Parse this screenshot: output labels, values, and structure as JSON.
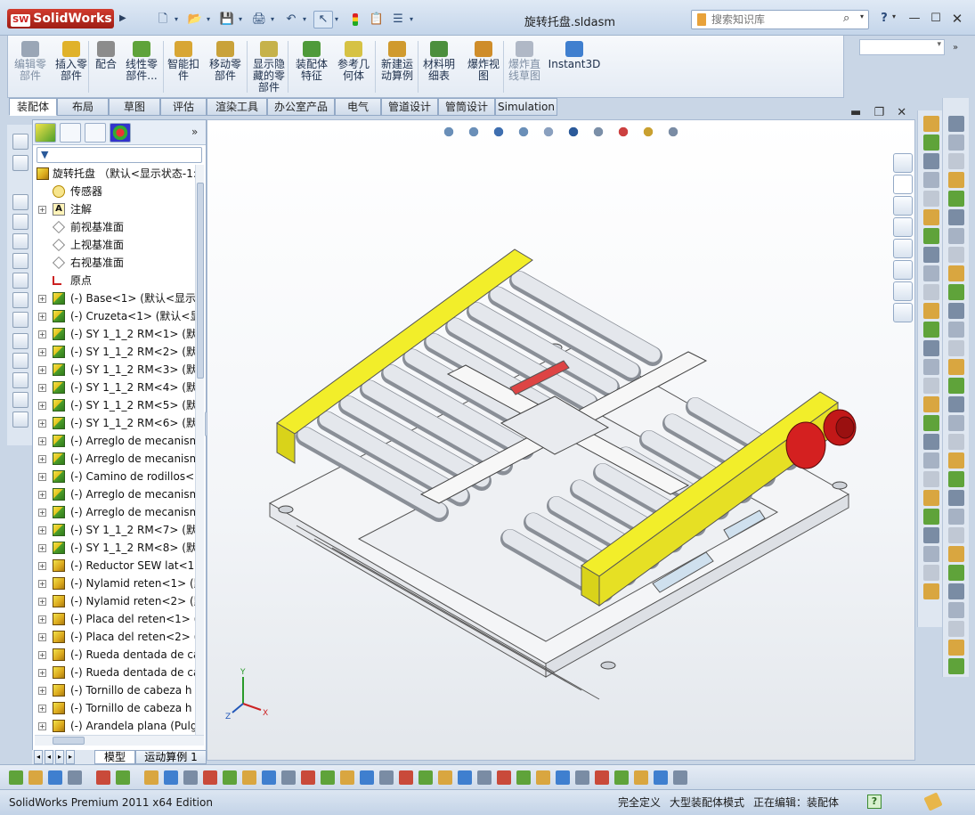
{
  "app": {
    "logo_text": "SolidWorks",
    "logo_badge": "SW",
    "document_title": "旋转托盘.sldasm",
    "search_placeholder": "搜索知识库",
    "help_label": "?"
  },
  "quick_access": [
    {
      "name": "new-document-icon",
      "glyph": "🗋"
    },
    {
      "name": "open-icon",
      "glyph": "📂"
    },
    {
      "name": "save-icon",
      "glyph": "💾"
    },
    {
      "name": "print-icon",
      "glyph": "🖨"
    },
    {
      "name": "undo-icon",
      "glyph": "↶"
    },
    {
      "name": "select-icon",
      "glyph": "↖"
    },
    {
      "name": "rebuild-icon",
      "glyph": "🚦"
    },
    {
      "name": "file-properties-icon",
      "glyph": "📋"
    },
    {
      "name": "options-icon",
      "glyph": "☰"
    }
  ],
  "ribbon": {
    "buttons": [
      {
        "label": "编辑零\n部件",
        "disabled": true,
        "color": "#9aa6b6"
      },
      {
        "label": "插入零\n部件",
        "disabled": false,
        "color": "#e0b22a"
      },
      {
        "label": "配合",
        "disabled": false,
        "color": "#8c8c8c"
      },
      {
        "label": "线性零\n部件...",
        "disabled": false,
        "color": "#5fa33a"
      },
      {
        "label": "智能扣\n件",
        "disabled": false,
        "color": "#d8a634"
      },
      {
        "label": "移动零\n部件",
        "disabled": false,
        "color": "#c9a23a"
      },
      {
        "label": "显示隐\n藏的零\n部件",
        "disabled": false,
        "color": "#c6b24a"
      },
      {
        "label": "装配体\n特征",
        "disabled": false,
        "color": "#4f9a3a"
      },
      {
        "label": "参考几\n何体",
        "disabled": false,
        "color": "#d6c244"
      },
      {
        "label": "新建运\n动算例",
        "disabled": false,
        "color": "#d09a2e"
      },
      {
        "label": "材料明\n细表",
        "disabled": false,
        "color": "#4c8f3d"
      },
      {
        "label": "爆炸视\n图",
        "disabled": false,
        "color": "#cf8d2a"
      },
      {
        "label": "爆炸直\n线草图",
        "disabled": true,
        "color": "#b0b8c6"
      },
      {
        "label": "Instant3D",
        "disabled": false,
        "color": "#3f7fcf"
      }
    ]
  },
  "tabs": [
    "装配体",
    "布局",
    "草图",
    "评估",
    "渲染工具",
    "办公室产品",
    "电气",
    "管道设计",
    "管筒设计",
    "Simulation"
  ],
  "active_tab": "装配体",
  "feature_tree": {
    "root_label": "旋转托盘 （默认<显示状态-1:",
    "items": [
      {
        "label": "传感器",
        "icon": "sensor",
        "expand": false
      },
      {
        "label": "注解",
        "icon": "note",
        "expand": true
      },
      {
        "label": "前视基准面",
        "icon": "plane",
        "expand": false
      },
      {
        "label": "上视基准面",
        "icon": "plane",
        "expand": false
      },
      {
        "label": "右视基准面",
        "icon": "plane",
        "expand": false
      },
      {
        "label": "原点",
        "icon": "origin",
        "expand": false
      },
      {
        "label": "(-) Base<1> (默认<显示:",
        "icon": "cube",
        "expand": true
      },
      {
        "label": "(-) Cruzeta<1> (默认<显",
        "icon": "cube",
        "expand": true
      },
      {
        "label": "(-) SY 1_1_2 RM<1> (默认",
        "icon": "cube",
        "expand": true
      },
      {
        "label": "(-) SY 1_1_2 RM<2> (默认",
        "icon": "cube",
        "expand": true
      },
      {
        "label": "(-) SY 1_1_2 RM<3> (默认",
        "icon": "cube",
        "expand": true
      },
      {
        "label": "(-) SY 1_1_2 RM<4> (默认",
        "icon": "cube",
        "expand": true
      },
      {
        "label": "(-) SY 1_1_2 RM<5> (默认",
        "icon": "cube",
        "expand": true
      },
      {
        "label": "(-) SY 1_1_2 RM<6> (默认",
        "icon": "cube",
        "expand": true
      },
      {
        "label": "(-) Arreglo de mecanism",
        "icon": "cube",
        "expand": true
      },
      {
        "label": "(-) Arreglo de mecanism",
        "icon": "cube",
        "expand": true
      },
      {
        "label": "(-) Camino de rodillos<",
        "icon": "cube",
        "expand": true
      },
      {
        "label": "(-) Arreglo de mecanism",
        "icon": "cube",
        "expand": true
      },
      {
        "label": "(-) Arreglo de mecanism",
        "icon": "cube",
        "expand": true
      },
      {
        "label": "(-) SY 1_1_2 RM<7> (默认",
        "icon": "cube",
        "expand": true
      },
      {
        "label": "(-) SY 1_1_2 RM<8> (默认",
        "icon": "cube",
        "expand": true
      },
      {
        "label": "(-) Reductor SEW lat<1:",
        "icon": "asm",
        "expand": true
      },
      {
        "label": "(-) Nylamid reten<1> (默",
        "icon": "asm",
        "expand": true
      },
      {
        "label": "(-) Nylamid reten<2> (默",
        "icon": "asm",
        "expand": true
      },
      {
        "label": "(-) Placa del reten<1> (",
        "icon": "asm",
        "expand": true
      },
      {
        "label": "(-) Placa del reten<2> (",
        "icon": "asm",
        "expand": true
      },
      {
        "label": "(-) Rueda dentada de ca",
        "icon": "asm",
        "expand": true
      },
      {
        "label": "(-) Rueda dentada de ca",
        "icon": "asm",
        "expand": true
      },
      {
        "label": "(-) Tornillo de cabeza h",
        "icon": "asm",
        "expand": true
      },
      {
        "label": "(-) Tornillo de cabeza h",
        "icon": "asm",
        "expand": true
      },
      {
        "label": "(-) Arandela plana (Pulg",
        "icon": "asm",
        "expand": true
      }
    ]
  },
  "bottom_tabs": [
    "模型",
    "运动算例 1"
  ],
  "triad": {
    "x": "X",
    "y": "Y",
    "z": "Z"
  },
  "status": {
    "app_edition": "SolidWorks Premium 2011 x64 Edition",
    "definition": "完全定义",
    "mode": "大型装配体模式",
    "editing": "正在编辑：装配体",
    "help_box": "?"
  },
  "colors": {
    "frame_yellow": "#f2ee2a",
    "roller_gray": "#d9dde3",
    "motor_red": "#d42020",
    "accent_blue": "#2b5a9a"
  }
}
